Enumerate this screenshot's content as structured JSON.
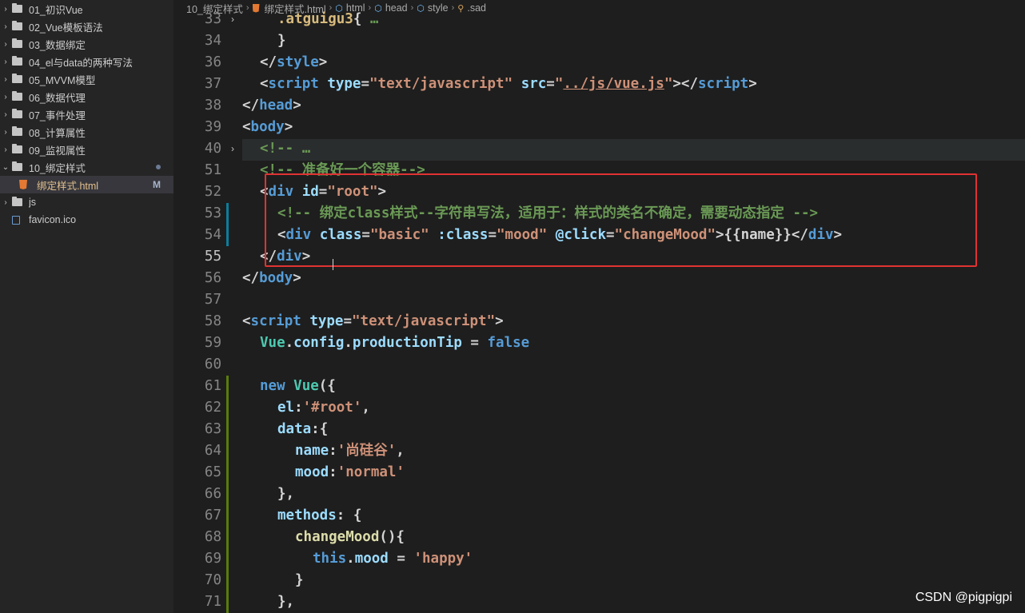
{
  "sidebar": {
    "items": [
      {
        "label": "01_初识Vue",
        "type": "folder",
        "expanded": false
      },
      {
        "label": "02_Vue模板语法",
        "type": "folder",
        "expanded": false
      },
      {
        "label": "03_数据绑定",
        "type": "folder",
        "expanded": false
      },
      {
        "label": "04_el与data的两种写法",
        "type": "folder",
        "expanded": false
      },
      {
        "label": "05_MVVM模型",
        "type": "folder",
        "expanded": false
      },
      {
        "label": "06_数据代理",
        "type": "folder",
        "expanded": false
      },
      {
        "label": "07_事件处理",
        "type": "folder",
        "expanded": false
      },
      {
        "label": "08_计算属性",
        "type": "folder",
        "expanded": false
      },
      {
        "label": "09_监视属性",
        "type": "folder",
        "expanded": false
      },
      {
        "label": "10_绑定样式",
        "type": "folder",
        "expanded": true,
        "modified_dot": true
      },
      {
        "label": "绑定样式.html",
        "type": "html-file",
        "badge": "M",
        "selected": true
      },
      {
        "label": "js",
        "type": "folder",
        "expanded": false
      },
      {
        "label": "favicon.ico",
        "type": "file"
      }
    ]
  },
  "breadcrumb": {
    "items": [
      "10_绑定样式",
      "绑定样式.html",
      "html",
      "head",
      "style",
      ".sad"
    ]
  },
  "editor": {
    "lines": [
      {
        "n": "33",
        "fold": true,
        "indent": 2,
        "toks": [
          [
            "yellowish",
            ".atguigu3"
          ],
          [
            "punc",
            "{ "
          ],
          [
            "cmt",
            "…"
          ]
        ]
      },
      {
        "n": "34",
        "indent": 2,
        "toks": [
          [
            "punc",
            "}"
          ]
        ]
      },
      {
        "n": "36",
        "indent": 1,
        "toks": [
          [
            "punc",
            "</"
          ],
          [
            "tag",
            "style"
          ],
          [
            "punc",
            ">"
          ]
        ]
      },
      {
        "n": "37",
        "indent": 1,
        "toks": [
          [
            "punc",
            "<"
          ],
          [
            "tag",
            "script"
          ],
          [
            "plain",
            " "
          ],
          [
            "attr",
            "type"
          ],
          [
            "punc",
            "="
          ],
          [
            "str",
            "\"text/javascript\""
          ],
          [
            "plain",
            " "
          ],
          [
            "attr",
            "src"
          ],
          [
            "punc",
            "="
          ],
          [
            "str",
            "\""
          ],
          [
            "strul",
            "../js/vue.js"
          ],
          [
            "str",
            "\""
          ],
          [
            "punc",
            "></"
          ],
          [
            "tag",
            "script"
          ],
          [
            "punc",
            ">"
          ]
        ]
      },
      {
        "n": "38",
        "indent": 0,
        "toks": [
          [
            "punc",
            "</"
          ],
          [
            "tag",
            "head"
          ],
          [
            "punc",
            ">"
          ]
        ]
      },
      {
        "n": "39",
        "indent": 0,
        "toks": [
          [
            "punc",
            "<"
          ],
          [
            "tag",
            "body"
          ],
          [
            "punc",
            ">"
          ]
        ]
      },
      {
        "n": "40",
        "fold": true,
        "indent": 1,
        "toks": [
          [
            "cmt",
            "<!-- "
          ],
          [
            "cmt",
            "…"
          ]
        ]
      },
      {
        "n": "51",
        "indent": 1,
        "toks": [
          [
            "cmt",
            "<!-- 准备好一个容器-->"
          ]
        ]
      },
      {
        "n": "52",
        "indent": 1,
        "toks": [
          [
            "punc",
            "<"
          ],
          [
            "tag",
            "div"
          ],
          [
            "plain",
            " "
          ],
          [
            "attr",
            "id"
          ],
          [
            "punc",
            "="
          ],
          [
            "str",
            "\"root\""
          ],
          [
            "punc",
            ">"
          ]
        ]
      },
      {
        "n": "53",
        "indent": 2,
        "toks": [
          [
            "cmt",
            "<!-- 绑定class样式--字符串写法，适用于：样式的类名不确定，需要动态指定 -->"
          ]
        ]
      },
      {
        "n": "54",
        "indent": 2,
        "toks": [
          [
            "punc",
            "<"
          ],
          [
            "tag",
            "div"
          ],
          [
            "plain",
            " "
          ],
          [
            "attr",
            "class"
          ],
          [
            "punc",
            "="
          ],
          [
            "str",
            "\"basic\""
          ],
          [
            "plain",
            " "
          ],
          [
            "attr",
            ":class"
          ],
          [
            "punc",
            "="
          ],
          [
            "str",
            "\"mood\""
          ],
          [
            "plain",
            " "
          ],
          [
            "attr",
            "@click"
          ],
          [
            "punc",
            "="
          ],
          [
            "str",
            "\"changeMood\""
          ],
          [
            "punc",
            ">"
          ],
          [
            "plain",
            "{{name}}"
          ],
          [
            "punc",
            "</"
          ],
          [
            "tag",
            "div"
          ],
          [
            "punc",
            ">"
          ]
        ]
      },
      {
        "n": "55",
        "indent": 1,
        "toks": [
          [
            "punc",
            "</"
          ],
          [
            "tag",
            "div"
          ],
          [
            "punc",
            ">"
          ]
        ]
      },
      {
        "n": "56",
        "indent": 0,
        "toks": [
          [
            "punc",
            "</"
          ],
          [
            "tag",
            "body"
          ],
          [
            "punc",
            ">"
          ]
        ]
      },
      {
        "n": "57",
        "indent": 0,
        "toks": []
      },
      {
        "n": "58",
        "indent": 0,
        "toks": [
          [
            "punc",
            "<"
          ],
          [
            "tag",
            "script"
          ],
          [
            "plain",
            " "
          ],
          [
            "attr",
            "type"
          ],
          [
            "punc",
            "="
          ],
          [
            "str",
            "\"text/javascript\""
          ],
          [
            "punc",
            ">"
          ]
        ]
      },
      {
        "n": "59",
        "indent": 1,
        "toks": [
          [
            "cls",
            "Vue"
          ],
          [
            "plain",
            "."
          ],
          [
            "var",
            "config"
          ],
          [
            "plain",
            "."
          ],
          [
            "var",
            "productionTip"
          ],
          [
            "plain",
            " = "
          ],
          [
            "kw",
            "false"
          ]
        ]
      },
      {
        "n": "60",
        "indent": 0,
        "toks": []
      },
      {
        "n": "61",
        "indent": 1,
        "toks": [
          [
            "kw",
            "new"
          ],
          [
            "plain",
            " "
          ],
          [
            "cls",
            "Vue"
          ],
          [
            "plain",
            "({"
          ]
        ]
      },
      {
        "n": "62",
        "indent": 2,
        "toks": [
          [
            "var",
            "el"
          ],
          [
            "plain",
            ":"
          ],
          [
            "str",
            "'#root'"
          ],
          [
            "plain",
            ","
          ]
        ]
      },
      {
        "n": "63",
        "indent": 2,
        "toks": [
          [
            "var",
            "data"
          ],
          [
            "plain",
            ":{"
          ]
        ]
      },
      {
        "n": "64",
        "indent": 3,
        "toks": [
          [
            "var",
            "name"
          ],
          [
            "plain",
            ":"
          ],
          [
            "str",
            "'尚硅谷'"
          ],
          [
            "plain",
            ","
          ]
        ]
      },
      {
        "n": "65",
        "indent": 3,
        "toks": [
          [
            "var",
            "mood"
          ],
          [
            "plain",
            ":"
          ],
          [
            "str",
            "'normal'"
          ]
        ]
      },
      {
        "n": "66",
        "indent": 2,
        "toks": [
          [
            "plain",
            "},"
          ]
        ]
      },
      {
        "n": "67",
        "indent": 2,
        "toks": [
          [
            "var",
            "methods"
          ],
          [
            "plain",
            ": {"
          ]
        ]
      },
      {
        "n": "68",
        "indent": 3,
        "toks": [
          [
            "fn",
            "changeMood"
          ],
          [
            "plain",
            "(){"
          ]
        ]
      },
      {
        "n": "69",
        "indent": 4,
        "toks": [
          [
            "kw",
            "this"
          ],
          [
            "plain",
            "."
          ],
          [
            "var",
            "mood"
          ],
          [
            "plain",
            " = "
          ],
          [
            "str",
            "'happy'"
          ]
        ]
      },
      {
        "n": "70",
        "indent": 3,
        "toks": [
          [
            "plain",
            "}"
          ]
        ]
      },
      {
        "n": "71",
        "indent": 2,
        "toks": [
          [
            "plain",
            "},"
          ]
        ]
      }
    ]
  },
  "watermark": "CSDN @pigpigpi",
  "colors": {
    "highlight_box": "#e03232",
    "editor_bg": "#1e1e1e",
    "sidebar_bg": "#252526"
  }
}
